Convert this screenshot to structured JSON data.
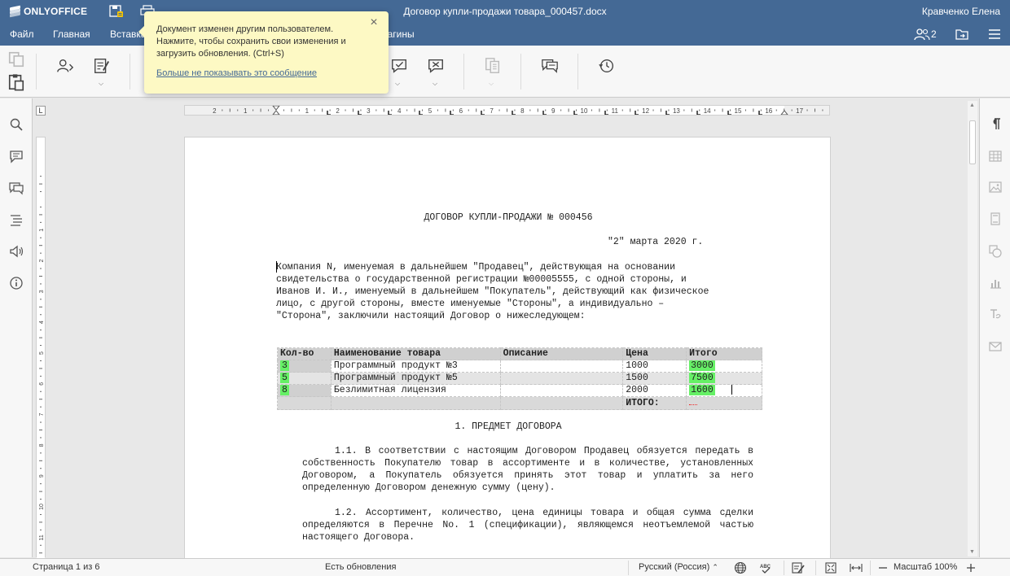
{
  "app": {
    "brand": "ONLYOFFICE",
    "document_title": "Договор купли-продажи товара_000457.docx",
    "user_name": "Кравченко Елена"
  },
  "menu": {
    "items": [
      "Файл",
      "Главная",
      "Вставка",
      "Плагины"
    ],
    "users_count": "2"
  },
  "notification": {
    "message": "Документ изменен другим пользователем. Нажмите, чтобы сохранить свои изменения и загрузить обновления. (Ctrl+S)",
    "link": "Больше не показывать это сообщение",
    "close": "×"
  },
  "ruler": {
    "corner": "L"
  },
  "document": {
    "heading": "ДОГОВОР КУПЛИ-ПРОДАЖИ № 000456",
    "date": "\"2\" марта 2020 г.",
    "intro": [
      "Компания N, именуемая в дальнейшем \"Продавец\", действующая на основании",
      "свидетельства о государственной регистрации №00005555, с одной стороны, и",
      "Иванов И. И., именуемый в дальнейшем \"Покупатель\", действующий как физическое",
      "лицо, с другой стороны, вместе именуемые \"Стороны\", а индивидуально –",
      "\"Сторона\", заключили настоящий Договор о нижеследующем:"
    ],
    "table": {
      "headers": [
        "Кол-во",
        "Наименование товара",
        "Описание",
        "Цена",
        "Итого"
      ],
      "rows": [
        {
          "qty": "3",
          "name": "Программный продукт №3",
          "desc": "",
          "price": "1000",
          "total": "3000"
        },
        {
          "qty": "5",
          "name": "Программный продукт №5",
          "desc": "",
          "price": "1500",
          "total": "7500"
        },
        {
          "qty": "8",
          "name": "Безлимитная лицензия",
          "desc": "",
          "price": "2000",
          "total": "1600"
        }
      ],
      "total_label": "ИТОГО:"
    },
    "section_title": "1. ПРЕДМЕТ ДОГОВОРА",
    "clause_1_1": "1.1. В соответствии с настоящим Договором Продавец обязуется передать в собственность Покупателю товар в ассортименте и в количестве, установленных Договором, а Покупатель обязуется принять этот товар и уплатить за него определенную Договором денежную сумму (цену).",
    "clause_1_2": "1.2. Ассортимент, количество, цена единицы товара и общая сумма сделки определяются в Перечне No. 1 (спецификации), являющемся неотъемлемой частью настоящего Договора."
  },
  "status": {
    "page": "Страница 1 из 6",
    "updates": "Есть обновления",
    "language": "Русский (Россия)",
    "zoom": "Масштаб 100%"
  },
  "colors": {
    "header_bg": "#446995",
    "highlight_green": "#66f066",
    "balloon_bg": "#fdf9c4"
  }
}
